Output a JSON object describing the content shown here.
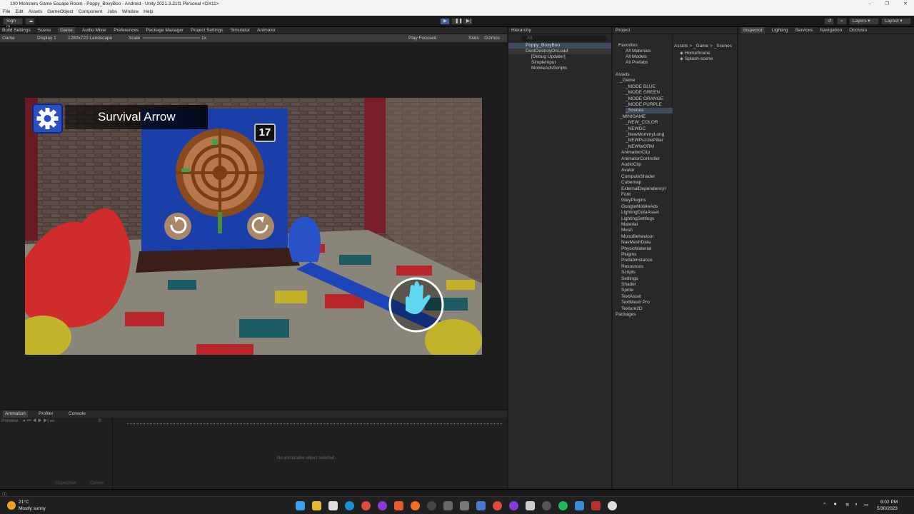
{
  "window": {
    "title": "100 Monsters Game Escape Room - Poppy_BoxyBoo - Android - Unity 2021.3.21f1 Personal <DX11>",
    "minimize": "–",
    "maximize": "❐",
    "close": "✕"
  },
  "menu": [
    "File",
    "Edit",
    "Assets",
    "GameObject",
    "Component",
    "Jobs",
    "Window",
    "Help"
  ],
  "toolbar": {
    "sign_in": "Sign in",
    "layers": "Layers",
    "layout": "Layout"
  },
  "editor_tabs": [
    {
      "label": "Build Settings"
    },
    {
      "label": "Scene"
    },
    {
      "label": "Game"
    },
    {
      "label": "Audio Mixer"
    },
    {
      "label": "Preferences"
    },
    {
      "label": "Package Manager"
    },
    {
      "label": "Project Settings"
    },
    {
      "label": "Simulator"
    },
    {
      "label": "Animator"
    }
  ],
  "game_bar": {
    "mode": "Game",
    "display": "Display 1",
    "resolution": "1280x720 Landscape",
    "scale_label": "Scale",
    "scale_value": "1x",
    "play_focused": "Play Focused",
    "stats": "Stats",
    "gizmos": "Gizmos"
  },
  "game": {
    "level_title": "Survival Arrow",
    "counter": "17"
  },
  "bottom_tabs": [
    {
      "label": "Animation"
    },
    {
      "label": "Profiler"
    },
    {
      "label": "Console"
    }
  ],
  "animation": {
    "preview": "Preview",
    "frame": "0",
    "empty_message": "No animatable object selected.",
    "dopesheet": "Dopesheet",
    "curves": "Curves"
  },
  "hierarchy": {
    "title": "Hierarchy",
    "search_placeholder": "All",
    "items": [
      {
        "label": "Poppy_BoxyBoo"
      },
      {
        "label": "DontDestroyOnLoad"
      },
      {
        "label": "[Debug Updater]"
      },
      {
        "label": "SimpleInput"
      },
      {
        "label": "MobileAdsScripts"
      }
    ]
  },
  "project": {
    "title": "Project",
    "favorites": [
      "Favorites",
      "All Materials",
      "All Models",
      "All Prefabs"
    ],
    "tree": [
      "Assets",
      "_Game",
      "_MODE BLUE",
      "_MODE GREEN",
      "_MODE ORANGE",
      "_MODE PURPLE",
      "_Scenes",
      "_MINIGAME",
      "_NEW_COLOR",
      "_NEWDC",
      "_NewMommyLong",
      "_NEWPuzzlePillar",
      "_NEWWORM",
      "AnimationClip",
      "AnimatorController",
      "AudioClip",
      "Avatar",
      "ComputeShader",
      "Cubemap",
      "ExternalDependencyI",
      "Font",
      "GleyPlugins",
      "GoogleMobileAds",
      "LightingDataAsset",
      "LightingSettings",
      "Material",
      "Mesh",
      "MonoBehaviour",
      "NavMeshData",
      "PhysicMaterial",
      "Plugins",
      "PrefabInstance",
      "Resources",
      "Scripts",
      "Settings",
      "Shader",
      "Sprite",
      "TextAsset",
      "TextMesh Pro",
      "Texture2D",
      "Packages"
    ],
    "breadcrumb": [
      "Assets",
      ">",
      "_Game",
      ">",
      "_Scenes"
    ],
    "files": [
      "HomeScene",
      "Splash-scene"
    ]
  },
  "inspector_tabs": [
    {
      "label": "Inspector"
    },
    {
      "label": "Lighting"
    },
    {
      "label": "Services"
    },
    {
      "label": "Navigation"
    },
    {
      "label": "Occlusio"
    }
  ],
  "taskbar": {
    "weather_temp": "21°C",
    "weather_desc": "Mostly sunny",
    "time": "8:02 PM",
    "date": "5/30/2023"
  },
  "colors": {
    "unity_bg": "#191919",
    "panel_bg": "#282828",
    "selection": "#3e5f96",
    "game_blue": "#1b3fa8",
    "settings_blue": "#2a4fc4"
  }
}
